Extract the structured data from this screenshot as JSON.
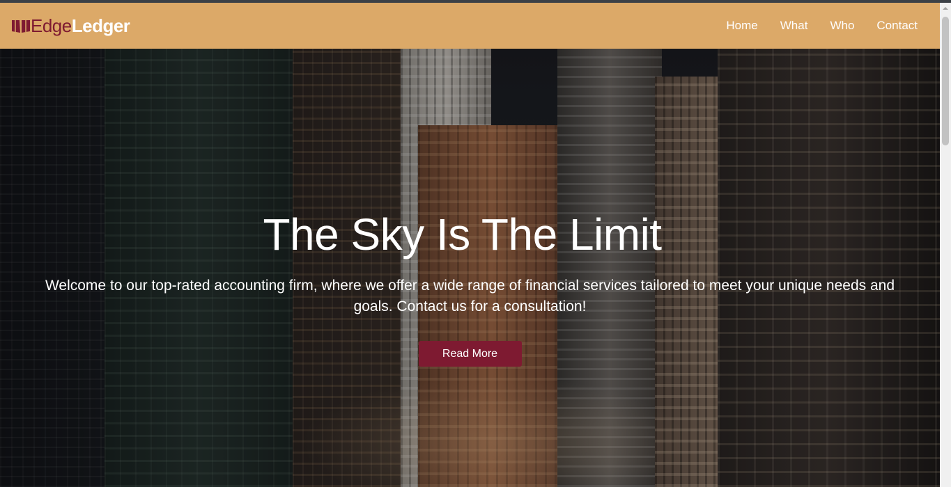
{
  "brand": {
    "part1": "Edge",
    "part2": "Ledger",
    "logo_icon": "book-icon"
  },
  "nav": {
    "items": [
      {
        "label": "Home"
      },
      {
        "label": "What"
      },
      {
        "label": "Who"
      },
      {
        "label": "Contact"
      }
    ]
  },
  "hero": {
    "title": "The Sky Is The Limit",
    "text": "Welcome to our top-rated accounting firm, where we offer a wide range of financial services tailored to meet your unique needs and goals. Contact us for a consultation!",
    "button": "Read More"
  },
  "colors": {
    "navbar": "#dca968",
    "accent": "#7e1a31",
    "text_light": "#ffffff"
  }
}
